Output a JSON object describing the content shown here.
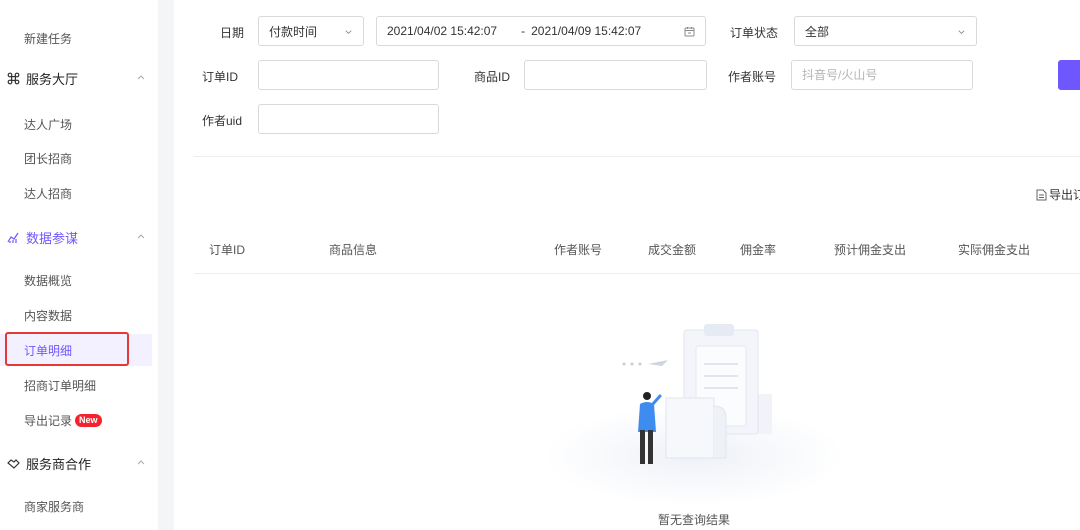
{
  "sidebar": {
    "top_item": "新建任务",
    "groups": [
      {
        "label": "服务大厅",
        "items": [
          "达人广场",
          "团长招商",
          "达人招商"
        ]
      },
      {
        "label": "数据参谋",
        "items": [
          "数据概览",
          "内容数据",
          "订单明细",
          "招商订单明细",
          "导出记录"
        ]
      },
      {
        "label": "服务商合作",
        "items": [
          "商家服务商"
        ]
      }
    ],
    "new_badge": "New",
    "selected_item": "订单明细"
  },
  "filters": {
    "date_label": "日期",
    "date_type": "付款时间",
    "start_time": "2021/04/02 15:42:07",
    "range_sep": "-",
    "end_time": "2021/04/09 15:42:07",
    "status_label": "订单状态",
    "status_value": "全部",
    "order_id_label": "订单ID",
    "product_id_label": "商品ID",
    "author_account_label": "作者账号",
    "author_account_placeholder": "抖音号/火山号",
    "author_uid_label": "作者uid"
  },
  "export_label": "导出订",
  "table": {
    "columns": [
      "订单ID",
      "商品信息",
      "作者账号",
      "成交金额",
      "佣金率",
      "预计佣金支出",
      "实际佣金支出"
    ]
  },
  "empty_text": "暂无查询结果",
  "colors": {
    "accent": "#6f57ff",
    "highlight": "#e53935",
    "badge": "#f5222d"
  }
}
